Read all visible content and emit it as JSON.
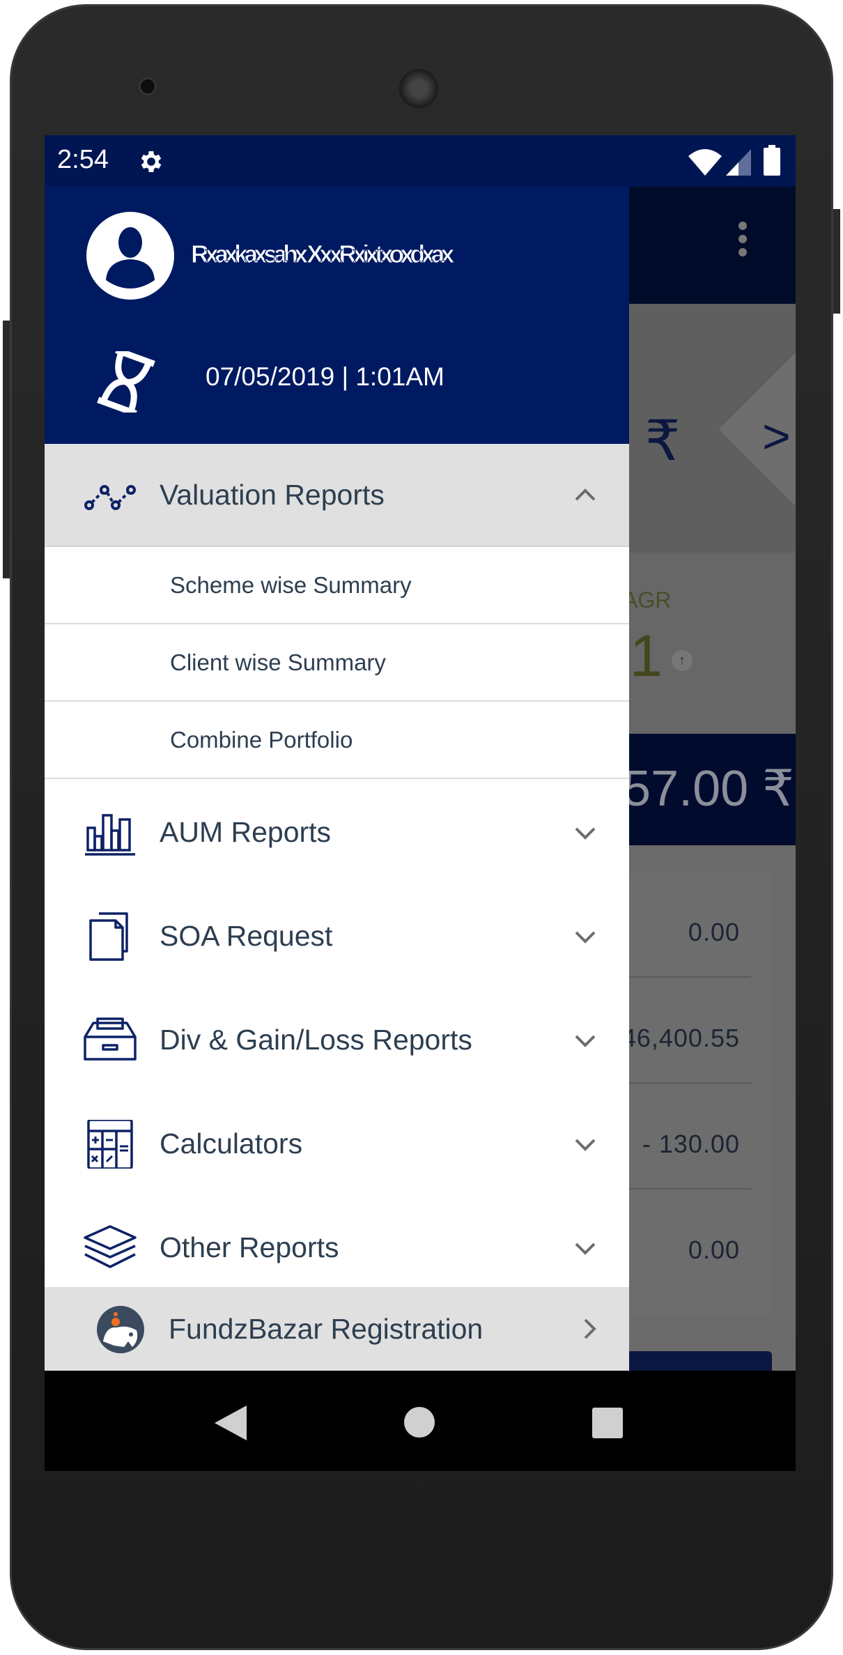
{
  "status_bar": {
    "time": "2:54",
    "icons": [
      "settings-icon",
      "wifi-icon",
      "signal-icon",
      "battery-icon"
    ]
  },
  "drawer": {
    "user_name": "Rxaxkaxsahx XxxRxixtxoxdxax",
    "last_login": "07/05/2019 | 1:01AM",
    "menu": [
      {
        "label": "Valuation Reports",
        "icon": "line-chart-icon",
        "expanded": true,
        "children": [
          "Scheme wise Summary",
          "Client wise Summary",
          "Combine Portfolio"
        ]
      },
      {
        "label": "AUM Reports",
        "icon": "bar-chart-icon"
      },
      {
        "label": "SOA Request",
        "icon": "documents-icon"
      },
      {
        "label": "Div & Gain/Loss Reports",
        "icon": "inbox-tray-icon"
      },
      {
        "label": "Calculators",
        "icon": "calculator-icon"
      },
      {
        "label": "Other Reports",
        "icon": "layers-icon"
      }
    ],
    "footer_item": {
      "label": "FundzBazar Registration",
      "icon": "fundzbazar-logo-icon"
    }
  },
  "background": {
    "hero_fragment": "1 ₹",
    "cagr_label": "AGR",
    "cagr_value": "1",
    "banner_value": "57.00 ₹",
    "card_values": [
      "0.00",
      "46,400.55",
      "- 130.00",
      "0.00"
    ]
  },
  "colors": {
    "primary": "#001a62",
    "status_bar": "#001652",
    "text": "#2d3e50",
    "icon": "#0d2266",
    "highlight_row": "#e0e0e0"
  }
}
